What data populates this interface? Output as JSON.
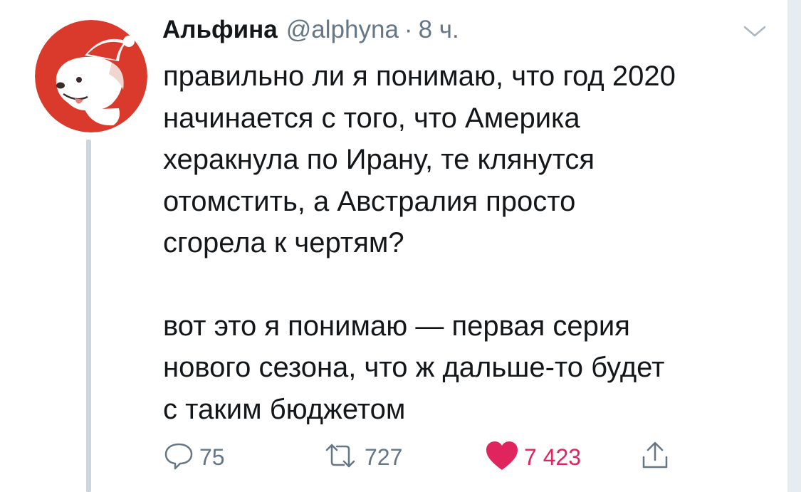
{
  "tweet": {
    "author_name": "Альфина",
    "handle": "@alphyna",
    "separator": "·",
    "time": "8 ч.",
    "paragraphs": [
      "правильно ли я понимаю, что год 2020\nначинается с того, что Америка\nхеракнула по Ирану, те клянутся\nотомстить, а Австралия просто\nсгорела к чертям?",
      "вот это я понимаю — первая серия\nнового сезона, что ж дальше-то будет\nс таким бюджетом"
    ]
  },
  "actions": {
    "replies": "75",
    "retweets": "727",
    "likes": "7 423",
    "liked": true
  },
  "colors": {
    "avatar_bg": "#d93a2b",
    "like": "#e0245e",
    "muted": "#657786",
    "thread_line": "#ccd6dd"
  },
  "icons": [
    "reply-icon",
    "retweet-icon",
    "heart-icon",
    "share-icon",
    "chevron-down-icon"
  ]
}
